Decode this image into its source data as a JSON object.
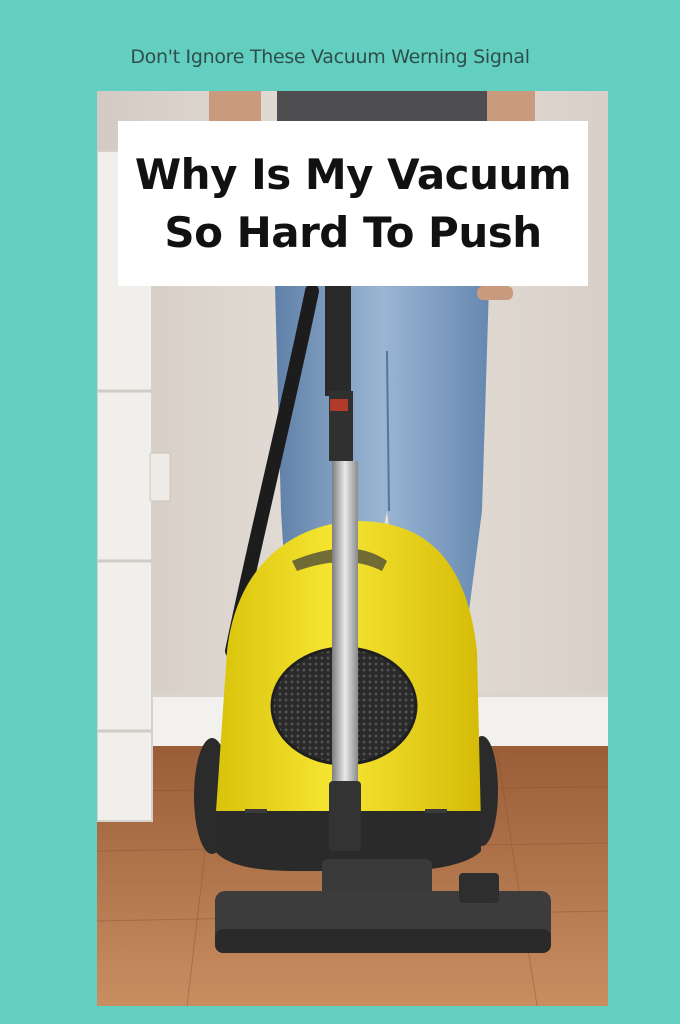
{
  "caption": "Don't Ignore These Vacuum Werning Signal",
  "title": {
    "line1": "Why Is My Vacuum",
    "line2": "So Hard To Push"
  },
  "photo": {
    "subject": "yellow canister vacuum cleaner on wooden floor",
    "colors": {
      "background": "#63cfc0",
      "vacuum_body": "#f1de1a",
      "floor": "#b9764a",
      "wall": "#e1dad3",
      "jeans": "#7d9ec2"
    }
  }
}
